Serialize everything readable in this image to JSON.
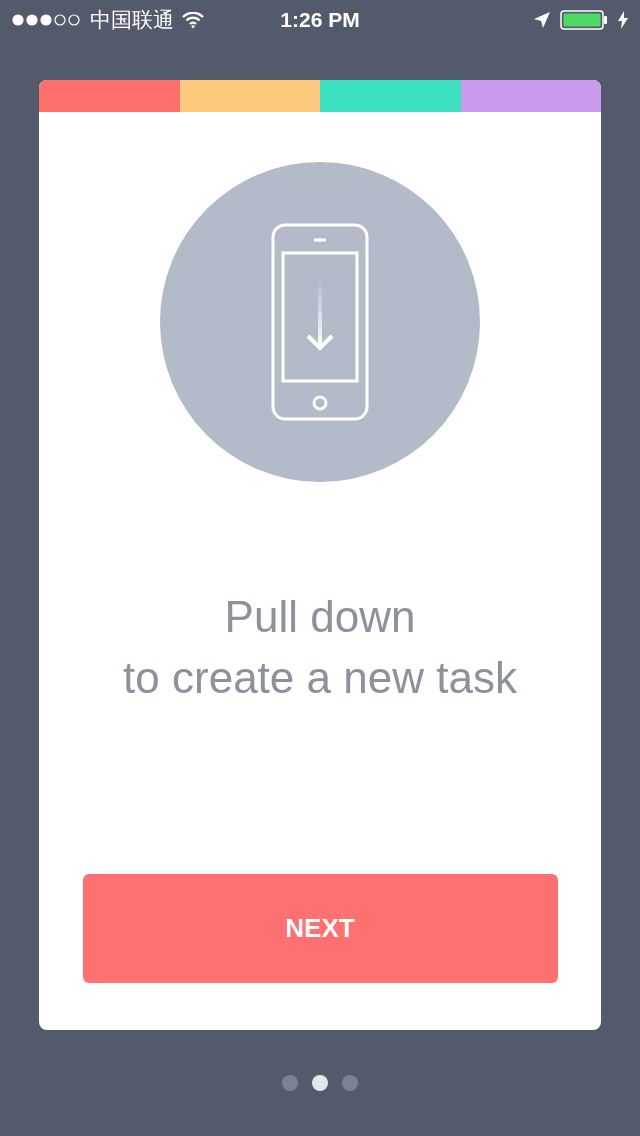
{
  "status_bar": {
    "carrier": "中国联通",
    "time": "1:26 PM"
  },
  "card": {
    "stripe": [
      {
        "color": "#ff6f6b"
      },
      {
        "color": "#ffc97d"
      },
      {
        "color": "#3ae0bf"
      },
      {
        "color": "#cb9aee"
      }
    ],
    "title_lines": [
      "Pull down",
      "to create a new task"
    ],
    "button": "NEXT"
  },
  "pager": [
    {
      "selected": false
    },
    {
      "selected": true
    },
    {
      "selected": false
    }
  ]
}
